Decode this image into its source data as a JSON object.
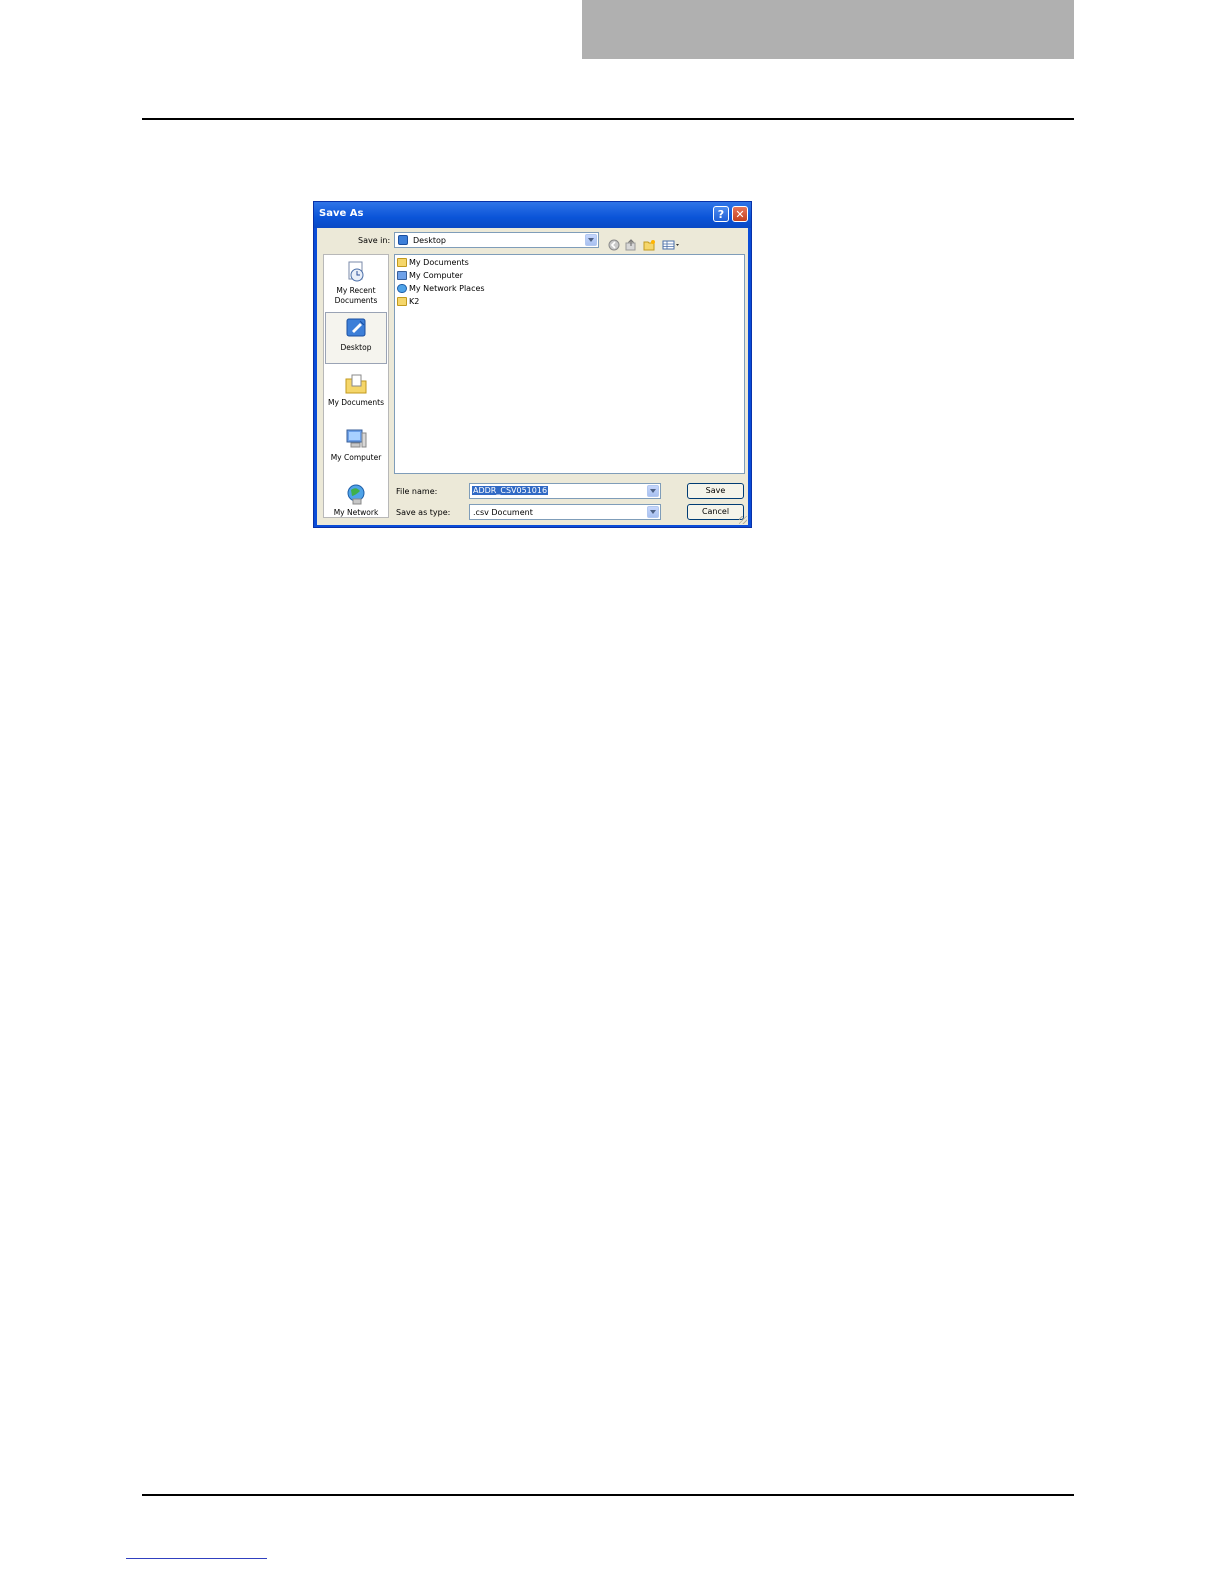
{
  "dialog": {
    "title": "Save As",
    "help_glyph": "?",
    "close_glyph": "✕",
    "save_in": {
      "label": "Save in:",
      "value": "Desktop",
      "icon": "desktop-icon"
    },
    "toolbar": {
      "back_icon": "back-icon",
      "up_icon": "up-folder-icon",
      "new_folder_icon": "new-folder-icon",
      "views_icon": "views-menu-icon"
    },
    "places": [
      {
        "label": "My Recent Documents",
        "line1": "My Recent",
        "line2": "Documents",
        "icon": "recent-documents-icon"
      },
      {
        "label": "Desktop",
        "icon": "desktop-icon"
      },
      {
        "label": "My Documents",
        "icon": "my-documents-icon"
      },
      {
        "label": "My Computer",
        "icon": "my-computer-icon"
      },
      {
        "label": "My Network",
        "icon": "network-icon"
      }
    ],
    "files": [
      {
        "name": "My Documents",
        "icon": "my-documents-icon"
      },
      {
        "name": "My Computer",
        "icon": "my-computer-icon"
      },
      {
        "name": "My Network Places",
        "icon": "network-icon"
      },
      {
        "name": "K2",
        "icon": "folder-icon"
      }
    ],
    "file_name": {
      "label": "File name:",
      "value": "ADDR_CSV051016"
    },
    "save_as_type": {
      "label": "Save as type:",
      "value": ".csv Document"
    },
    "buttons": {
      "save": "Save",
      "cancel": "Cancel"
    }
  },
  "colors": {
    "title_bar": "#0a54d8",
    "dialog_face": "#ece9d8",
    "selection": "#316ac5",
    "header_tab": "#b0b0b0"
  }
}
